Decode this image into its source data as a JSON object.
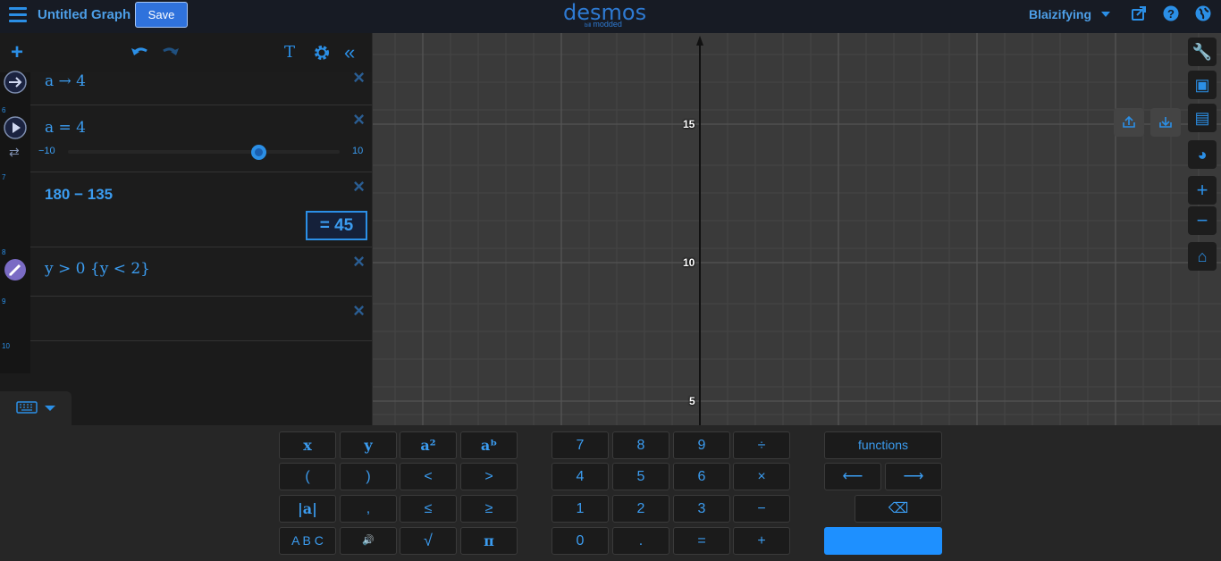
{
  "topbar": {
    "title": "Untitled Graph",
    "save_label": "Save",
    "logo": "desmos",
    "logo_sub_prefix": "bill",
    "logo_sub": "modded",
    "user": "Blaizifying"
  },
  "expressions": [
    {
      "index": "",
      "latex": "a → 4",
      "icon": "arrow-right-icon"
    },
    {
      "index": "6",
      "latex": "a = 4",
      "icon": "play-icon",
      "slider": {
        "min": "−10",
        "max": "10",
        "value": 4
      }
    },
    {
      "index": "7",
      "latex": "180 − 135",
      "result": "= 45"
    },
    {
      "index": "8",
      "latex": "y > 0 {y < 2}",
      "icon": "color-pencil-icon"
    },
    {
      "index": "9",
      "latex": ""
    },
    {
      "index": "10",
      "latex": ""
    }
  ],
  "graph": {
    "y_ticks": [
      "15",
      "10",
      "5"
    ]
  },
  "keypad": {
    "left": [
      [
        "x",
        "y",
        "a²",
        "aᵇ"
      ],
      [
        "(",
        ")",
        "<",
        ">"
      ],
      [
        "|a|",
        ",",
        "≤",
        "≥"
      ],
      [
        "A B C",
        "🔊",
        "√",
        "π"
      ]
    ],
    "middle": [
      [
        "7",
        "8",
        "9",
        "÷"
      ],
      [
        "4",
        "5",
        "6",
        "×"
      ],
      [
        "1",
        "2",
        "3",
        "−"
      ],
      [
        "0",
        ".",
        "=",
        "+"
      ]
    ],
    "functions_label": "functions",
    "left_arrow": "⟵",
    "right_arrow": "⟶",
    "backspace": "⌫"
  },
  "colors": {
    "accent": "#2b8fe6",
    "topbar": "#171b24",
    "panel": "#1b1b1b",
    "graph_bg": "#3a3a3a",
    "enter_key": "#1e90ff"
  }
}
